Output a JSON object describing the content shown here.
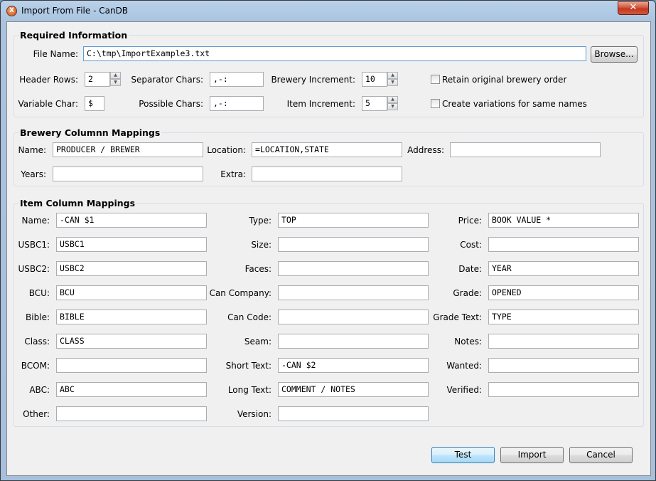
{
  "window": {
    "title": "Import From File - CanDB",
    "app_icon_glyph": "X",
    "close_glyph": "✕"
  },
  "required": {
    "title": "Required Information",
    "file_name": {
      "label": "File Name:",
      "value": "C:\\tmp\\ImportExample3.txt"
    },
    "browse_label": "Browse...",
    "header_rows": {
      "label": "Header Rows:",
      "value": "2"
    },
    "separator_chars": {
      "label": "Separator Chars:",
      "value": ",-:"
    },
    "brewery_increment": {
      "label": "Brewery Increment:",
      "value": "10"
    },
    "retain_order": {
      "label": "Retain original brewery order",
      "checked": false
    },
    "variable_char": {
      "label": "Variable Char:",
      "value": "$"
    },
    "possible_chars": {
      "label": "Possible Chars:",
      "value": ",-:"
    },
    "item_increment": {
      "label": "Item Increment:",
      "value": "5"
    },
    "create_variations": {
      "label": "Create variations for same names",
      "checked": false
    }
  },
  "brewery": {
    "title": "Brewery Columnn Mappings",
    "name": {
      "label": "Name:",
      "value": "PRODUCER / BREWER"
    },
    "location": {
      "label": "Location:",
      "value": "=LOCATION,STATE"
    },
    "address": {
      "label": "Address:",
      "value": ""
    },
    "years": {
      "label": "Years:",
      "value": ""
    },
    "extra": {
      "label": "Extra:",
      "value": ""
    }
  },
  "item": {
    "title": "Item Column Mappings",
    "col1": [
      {
        "label": "Name:",
        "value": "-CAN $1"
      },
      {
        "label": "USBC1:",
        "value": "USBC1"
      },
      {
        "label": "USBC2:",
        "value": "USBC2"
      },
      {
        "label": "BCU:",
        "value": "BCU"
      },
      {
        "label": "Bible:",
        "value": "BIBLE"
      },
      {
        "label": "Class:",
        "value": "CLASS"
      },
      {
        "label": "BCOM:",
        "value": ""
      },
      {
        "label": "ABC:",
        "value": "ABC"
      },
      {
        "label": "Other:",
        "value": ""
      }
    ],
    "col2": [
      {
        "label": "Type:",
        "value": "TOP"
      },
      {
        "label": "Size:",
        "value": ""
      },
      {
        "label": "Faces:",
        "value": ""
      },
      {
        "label": "Can Company:",
        "value": ""
      },
      {
        "label": "Can Code:",
        "value": ""
      },
      {
        "label": "Seam:",
        "value": ""
      },
      {
        "label": "Short Text:",
        "value": "-CAN $2"
      },
      {
        "label": "Long Text:",
        "value": "COMMENT / NOTES"
      },
      {
        "label": "Version:",
        "value": ""
      }
    ],
    "col3": [
      {
        "label": "Price:",
        "value": "BOOK VALUE *"
      },
      {
        "label": "Cost:",
        "value": ""
      },
      {
        "label": "Date:",
        "value": "YEAR"
      },
      {
        "label": "Grade:",
        "value": "OPENED"
      },
      {
        "label": "Grade Text:",
        "value": "TYPE"
      },
      {
        "label": "Notes:",
        "value": ""
      },
      {
        "label": "Wanted:",
        "value": ""
      },
      {
        "label": "Verified:",
        "value": ""
      }
    ]
  },
  "buttons": {
    "test": "Test",
    "import": "Import",
    "cancel": "Cancel"
  },
  "spin_up": "▲",
  "spin_down": "▼"
}
